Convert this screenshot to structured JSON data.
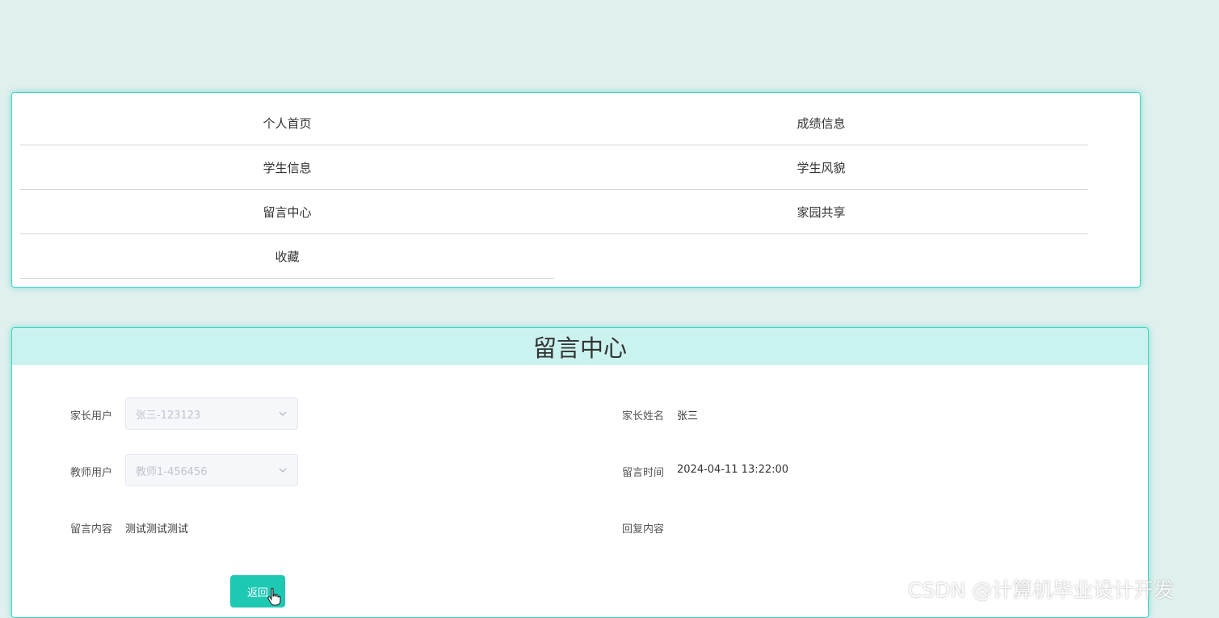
{
  "menu": {
    "items": [
      {
        "label": "个人首页"
      },
      {
        "label": "成绩信息"
      },
      {
        "label": "学生信息"
      },
      {
        "label": "学生风貌"
      },
      {
        "label": "留言中心"
      },
      {
        "label": "家园共享"
      },
      {
        "label": "收藏"
      }
    ]
  },
  "form": {
    "title": "留言中心",
    "parent_user": {
      "label": "家长用户",
      "placeholder": "张三-123123"
    },
    "parent_name": {
      "label": "家长姓名",
      "value": "张三"
    },
    "teacher_user": {
      "label": "教师用户",
      "placeholder": "教师1-456456"
    },
    "message_time": {
      "label": "留言时间",
      "value": "2024-04-11 13:22:00"
    },
    "message_content": {
      "label": "留言内容",
      "value": "测试测试测试"
    },
    "reply_content": {
      "label": "回复内容",
      "value": ""
    },
    "back_label": "返回"
  },
  "watermark": "CSDN @计算机毕业设计开发",
  "colors": {
    "background": "#e0f0ee",
    "accent": "#1ec9b4",
    "header_bg": "#caf2ee",
    "border": "#3fd4c4"
  }
}
